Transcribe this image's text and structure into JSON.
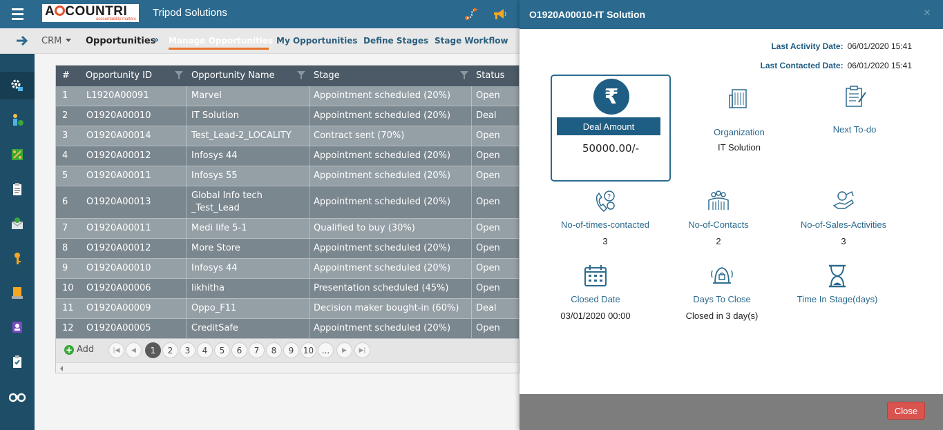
{
  "header": {
    "brand": "ACCOUNTRI",
    "brand_tagline": "accountability matters",
    "company": "Tripod Solutions",
    "icons": [
      "hamburger-icon",
      "map-route-icon",
      "megaphone-icon"
    ]
  },
  "tabs": {
    "module": "CRM",
    "breadcrumb": "Opportunities",
    "items": [
      "Manage Opportunities",
      "My Opportunities",
      "Define Stages",
      "Stage Workflow"
    ],
    "active": "Manage Opportunities"
  },
  "sidebar": {
    "items": [
      "settings-icon",
      "user-money-icon",
      "percentage-icon",
      "clipboard-icon",
      "money-envelope-icon",
      "key-icon",
      "archive-icon",
      "id-badge-icon",
      "checklist-icon",
      "binoculars-icon"
    ],
    "active": "settings-icon"
  },
  "grid": {
    "columns": [
      "#",
      "Opportunity ID",
      "Opportunity Name",
      "Stage",
      "Status"
    ],
    "rows": [
      {
        "n": "1",
        "id": "L1920A00091",
        "name": "Marvel",
        "stage": "Appointment scheduled (20%)",
        "status": "Open"
      },
      {
        "n": "2",
        "id": "O1920A00010",
        "name": "IT Solution",
        "stage": "Appointment scheduled (20%)",
        "status": "Deal"
      },
      {
        "n": "3",
        "id": "O1920A00014",
        "name": "Test_Lead-2_LOCALITY",
        "stage": "Contract sent (70%)",
        "status": "Open"
      },
      {
        "n": "4",
        "id": "O1920A00012",
        "name": "Infosys 44",
        "stage": "Appointment scheduled (20%)",
        "status": "Open"
      },
      {
        "n": "5",
        "id": "O1920A00011",
        "name": "Infosys 55",
        "stage": "Appointment scheduled (20%)",
        "status": "Open"
      },
      {
        "n": "6",
        "id": "O1920A00013",
        "name": "Global Info tech _Test_Lead",
        "stage": "Appointment scheduled (20%)",
        "status": "Open"
      },
      {
        "n": "7",
        "id": "O1920A00011",
        "name": "Medi life 5-1",
        "stage": "Qualified to buy (30%)",
        "status": "Open"
      },
      {
        "n": "8",
        "id": "O1920A00012",
        "name": "More Store",
        "stage": "Appointment scheduled (20%)",
        "status": "Open"
      },
      {
        "n": "9",
        "id": "O1920A00010",
        "name": "Infosys 44",
        "stage": "Appointment scheduled (20%)",
        "status": "Open"
      },
      {
        "n": "10",
        "id": "O1920A00006",
        "name": "likhitha",
        "stage": "Presentation scheduled (45%)",
        "status": "Open"
      },
      {
        "n": "11",
        "id": "O1920A00009",
        "name": "Oppo_F11",
        "stage": "Decision maker bought-in (60%)",
        "status": "Deal"
      },
      {
        "n": "12",
        "id": "O1920A00005",
        "name": "CreditSafe",
        "stage": "Appointment scheduled (20%)",
        "status": "Open"
      }
    ],
    "add_label": "Add",
    "pages": [
      "1",
      "2",
      "3",
      "4",
      "5",
      "6",
      "7",
      "8",
      "9",
      "10",
      "..."
    ],
    "current_page": "1"
  },
  "panel": {
    "title": "O1920A00010-IT Solution",
    "last_activity_label": "Last Activity Date:",
    "last_activity_value": "06/01/2020 15:41",
    "last_contacted_label": "Last Contacted Date:",
    "last_contacted_value": "06/01/2020 15:41",
    "deal": {
      "symbol": "₹",
      "label": "Deal Amount",
      "value": "50000.00/-"
    },
    "organization": {
      "label": "Organization",
      "value": "IT Solution"
    },
    "next_todo": {
      "label": "Next To-do",
      "value": ""
    },
    "times_contacted": {
      "label": "No-of-times-contacted",
      "value": "3"
    },
    "contacts": {
      "label": "No-of-Contacts",
      "value": "2"
    },
    "sales_activities": {
      "label": "No-of-Sales-Activities",
      "value": "3"
    },
    "closed_date": {
      "label": "Closed Date",
      "value": "03/01/2020 00:00"
    },
    "days_to_close": {
      "label": "Days To Close",
      "value": "Closed in 3 day(s)"
    },
    "time_in_stage": {
      "label": "Time In Stage(days)",
      "value": ""
    },
    "close_label": "Close"
  },
  "colors": {
    "header": "#2b6a8e",
    "sidebar": "#1e4d68",
    "accent": "#e8742c",
    "close": "#d9534f"
  }
}
